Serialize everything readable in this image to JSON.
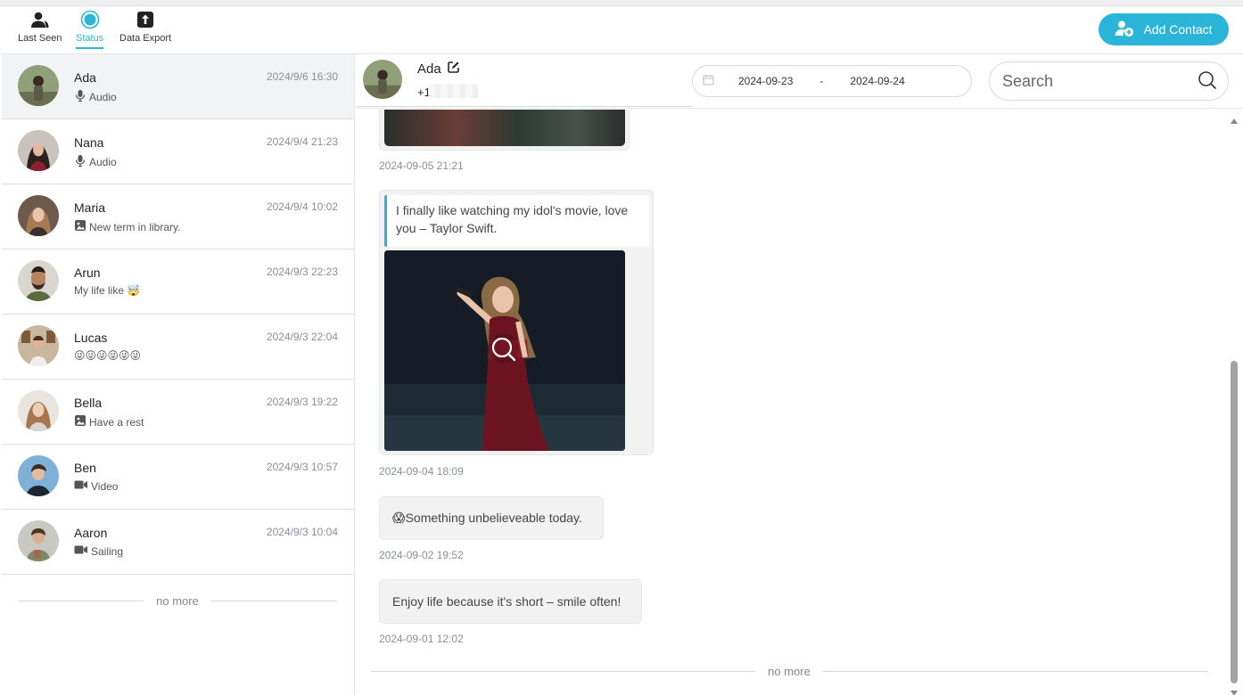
{
  "nav": {
    "tabs": [
      {
        "label": "Last Seen",
        "icon": "person-icon"
      },
      {
        "label": "Status",
        "icon": "status-icon"
      },
      {
        "label": "Data Export",
        "icon": "upload-icon"
      }
    ],
    "active_tab": "Status",
    "add_contact_label": "Add Contact"
  },
  "contacts": [
    {
      "name": "Ada",
      "time": "2024/9/6 16:30",
      "preview": "Audio",
      "preview_icon": "mic-icon"
    },
    {
      "name": "Nana",
      "time": "2024/9/4 21:23",
      "preview": "Audio",
      "preview_icon": "mic-icon"
    },
    {
      "name": "Maria",
      "time": "2024/9/4 10:02",
      "preview": "New term in library.",
      "preview_icon": "image-icon"
    },
    {
      "name": "Arun",
      "time": "2024/9/3 22:23",
      "preview": "My life like 🤯",
      "preview_icon": ""
    },
    {
      "name": "Lucas",
      "time": "2024/9/3 22:04",
      "preview": "😜😜😜😜😜😜",
      "preview_icon": ""
    },
    {
      "name": "Bella",
      "time": "2024/9/3 19:22",
      "preview": "Have a rest",
      "preview_icon": "image-icon"
    },
    {
      "name": "Ben",
      "time": "2024/9/3 10:57",
      "preview": "Video",
      "preview_icon": "video-icon"
    },
    {
      "name": "Aaron",
      "time": "2024/9/3 10:04",
      "preview": "Sailing",
      "preview_icon": "video-icon"
    }
  ],
  "contacts_end_text": "no more",
  "chat": {
    "contact_name": "Ada",
    "phone_prefix": "+1",
    "date_from": "2024-09-23",
    "date_sep": "-",
    "date_to": "2024-09-24",
    "search_placeholder": "Search",
    "messages": [
      {
        "time": "2024-09-05 21:21"
      },
      {
        "text": "I finally like watching my idol's movie, love you – Taylor Swift.",
        "time": "2024-09-04 18:09"
      },
      {
        "text": "😱Something unbelieveable today.",
        "time": "2024-09-02 19:52"
      },
      {
        "text": "Enjoy life because it's short – smile often!",
        "time": "2024-09-01 12:02"
      }
    ],
    "end_text": "no more"
  },
  "colors": {
    "accent": "#2ab4d8",
    "selected_row": "#f2f3f5",
    "bubble": "#f2f2f3"
  }
}
